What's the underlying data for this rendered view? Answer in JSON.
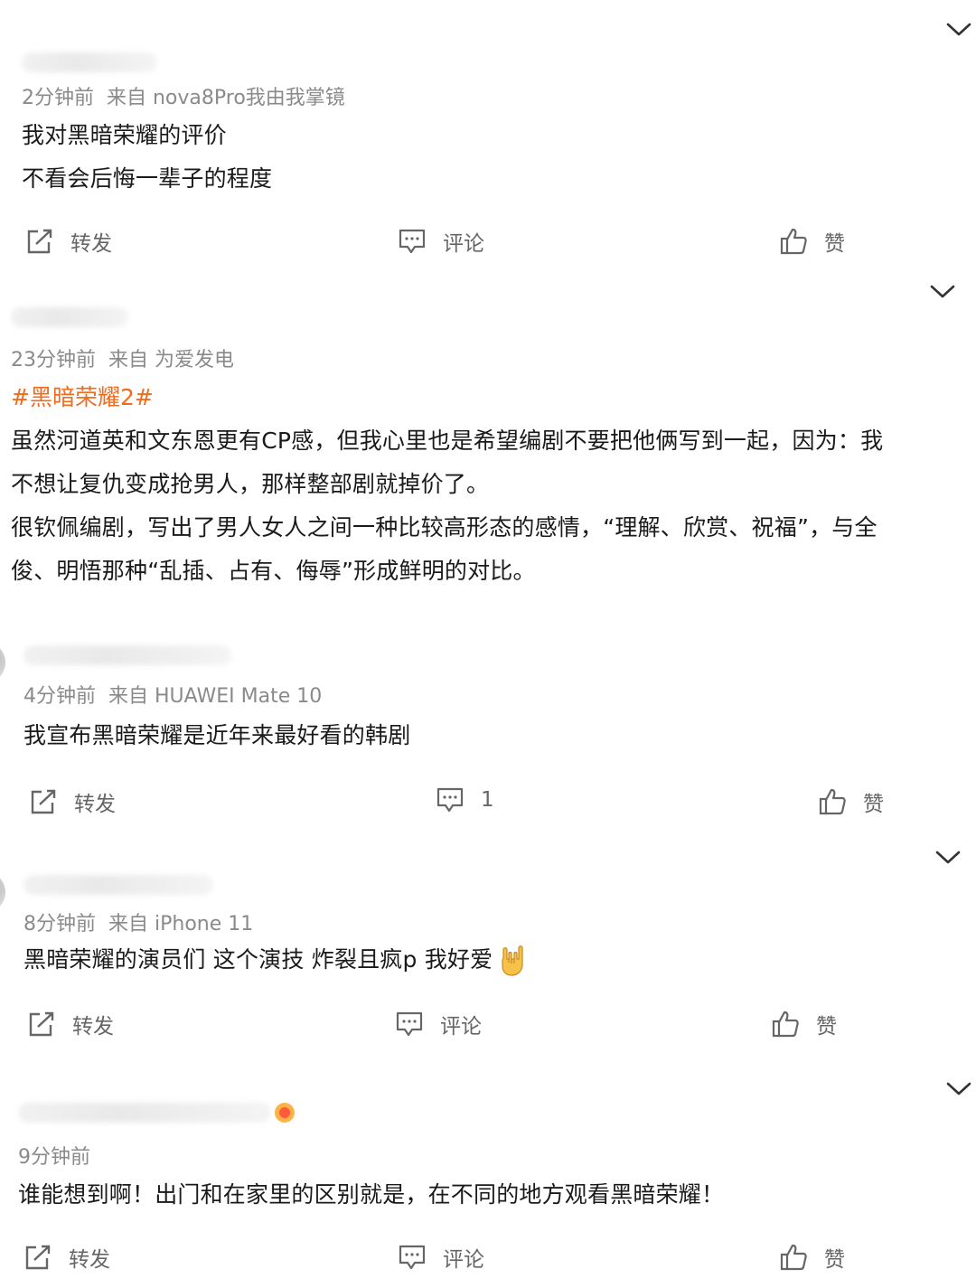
{
  "posts": [
    {
      "time": "2分钟前",
      "source": "来自 nova8Pro我由我掌镜",
      "lines": [
        "我对黑暗荣耀的评价",
        "不看会后悔一辈子的程度"
      ],
      "repost_label": "转发",
      "comment_label": "评论",
      "like_label": "赞"
    },
    {
      "time": "23分钟前",
      "source": "来自 为爱发电",
      "topic": "#黑暗荣耀2#",
      "lines": [
        "虽然河道英和文东恩更有CP感，但我心里也是希望编剧不要把他俩写到一起，因为：我",
        "不想让复仇变成抢男人，那样整部剧就掉价了。",
        "很钦佩编剧，写出了男人女人之间一种比较高形态的感情，“理解、欣赏、祝福”，与全",
        "俊、明悟那种“乱插、占有、侮辱”形成鲜明的对比。"
      ]
    },
    {
      "time": "4分钟前",
      "source": "来自 HUAWEI Mate 10",
      "lines": [
        "我宣布黑暗荣耀是近年来最好看的韩剧"
      ],
      "repost_label": "转发",
      "comment_count": "1",
      "like_label": "赞"
    },
    {
      "time": "8分钟前",
      "source": "来自 iPhone 11",
      "lines": [
        "黑暗荣耀的演员们 这个演技 炸裂且疯p 我好爱"
      ],
      "emoji": "rock-on-hand-icon",
      "repost_label": "转发",
      "comment_label": "评论",
      "like_label": "赞"
    },
    {
      "time": "9分钟前",
      "lines": [
        "谁能想到啊！出门和在家里的区别就是，在不同的地方观看黑暗荣耀！"
      ],
      "repost_label": "转发",
      "comment_label": "评论",
      "like_label": "赞"
    }
  ],
  "colors": {
    "text": "#1a1a1a",
    "meta": "#8a8a8a",
    "action": "#666666",
    "topic": "#f26b1d",
    "background": "#ffffff"
  },
  "icons": {
    "expand": "chevron-down-icon",
    "repost": "repost-icon",
    "comment": "comment-icon",
    "like": "thumbs-up-icon"
  }
}
